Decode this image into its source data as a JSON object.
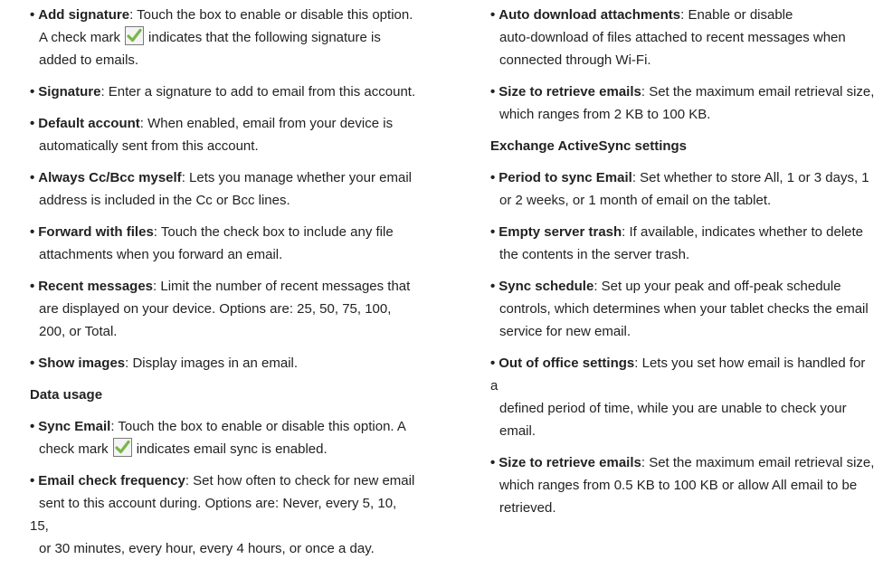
{
  "left_column": {
    "add_signature": {
      "term": "Add signature",
      "line1": ": Touch the box to enable or disable this option.",
      "line2a": "A check mark",
      "line2b": "indicates that the following signature is",
      "line3": "added to emails."
    },
    "signature": {
      "term": "Signature",
      "text": ": Enter a signature to add to email from this account."
    },
    "default_account": {
      "term": "Default account",
      "line1": ": When enabled, email from your device is",
      "line2": "automatically sent from this account."
    },
    "always_cc": {
      "term": "Always Cc/Bcc myself",
      "line1": ": Lets you manage whether your email",
      "line2": "address is included in the Cc or Bcc lines."
    },
    "forward_files": {
      "term": "Forward with files",
      "line1": ": Touch the check box to include any file",
      "line2": "attachments when you forward an email."
    },
    "recent_messages": {
      "term": "Recent messages",
      "line1": ": Limit the number of recent messages that",
      "line2": "are displayed on your device. Options are: 25, 50, 75, 100,",
      "line3": "200, or Total."
    },
    "show_images": {
      "term": "Show images",
      "text": ": Display images in an email."
    },
    "data_usage_heading": "Data usage",
    "sync_email": {
      "term": "Sync Email",
      "line1": ": Touch the box to enable or disable this option. A",
      "line2a": "check mark",
      "line2b": "indicates email sync is enabled."
    },
    "check_frequency": {
      "term": "Email check frequency",
      "line1": ": Set how often to check for new email",
      "line2": "sent to this account during. Options are: Never, every 5, 10, 15,",
      "line3": "or 30 minutes, every hour, every 4 hours, or once a day."
    }
  },
  "right_column": {
    "auto_download": {
      "term": "Auto download attachments",
      "line1": ": Enable or disable",
      "line2": "auto-download of files attached to recent messages when",
      "line3": "connected through Wi-Fi."
    },
    "size_retrieve_1": {
      "term": "Size to retrieve emails",
      "line1": ": Set the maximum email retrieval size,",
      "line2": "which ranges from 2 KB to 100 KB."
    },
    "exchange_heading": "Exchange ActiveSync settings",
    "period_sync": {
      "term": "Period to sync Email",
      "line1": ": Set whether to store All, 1 or 3 days, 1",
      "line2": "or 2 weeks, or 1 month of email on the tablet."
    },
    "empty_trash": {
      "term": "Empty server trash",
      "line1": ": If available, indicates whether to delete",
      "line2": "the contents in the server trash."
    },
    "sync_schedule": {
      "term": "Sync schedule",
      "line1": ": Set up your peak and off-peak schedule",
      "line2": "controls, which determines when your tablet checks the email",
      "line3": "service for new email."
    },
    "out_of_office": {
      "term": "Out of office settings",
      "line1": ": Lets you set how email is handled for a",
      "line2": "defined period of time, while you are unable to check your",
      "line3": "email."
    },
    "size_retrieve_2": {
      "term": "Size to retrieve emails",
      "line1": ": Set the maximum email retrieval size,",
      "line2": "which ranges from 0.5 KB to 100 KB or allow All email to be",
      "line3": "retrieved."
    }
  },
  "bullet_glyph": "•",
  "check_color": "#7ab648",
  "icons": {
    "checkmark": "green-checkmark-box-icon"
  }
}
